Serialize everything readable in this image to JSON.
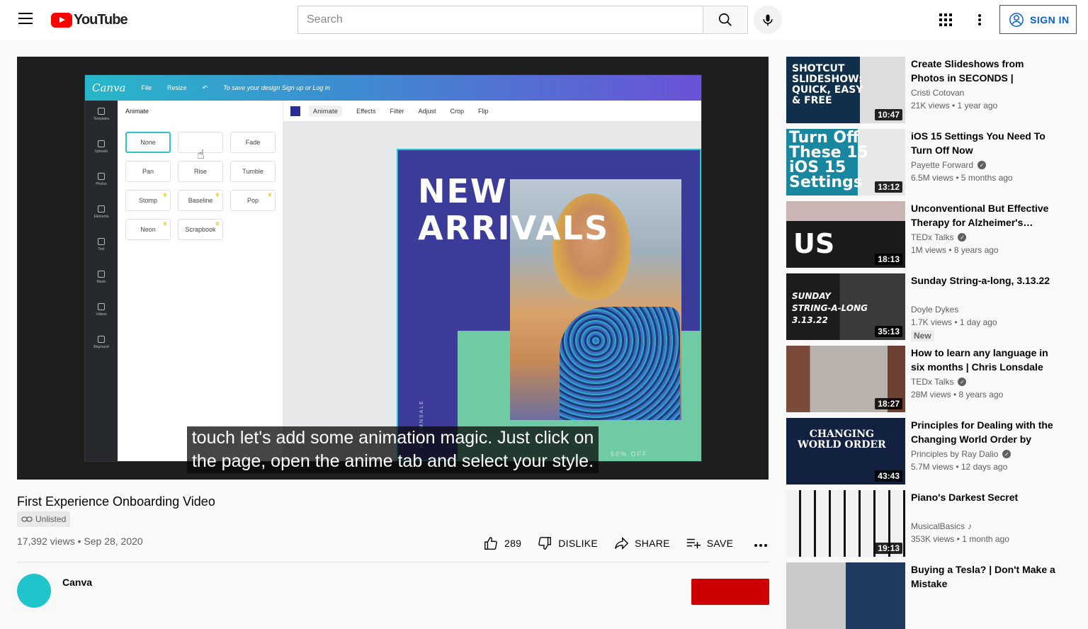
{
  "header": {
    "logo_text": "YouTube",
    "search_placeholder": "Search",
    "signin_label": "SIGN IN"
  },
  "player": {
    "canva": {
      "logo": "Canva",
      "menu_file": "File",
      "menu_resize": "Resize",
      "save_prompt": "To save your design Sign up or Log in",
      "panel_title": "Animate",
      "sidebar": [
        "Templates",
        "Uploads",
        "Photos",
        "Elements",
        "Text",
        "Music",
        "Videos",
        "Bkground"
      ],
      "animations": [
        {
          "label": "None",
          "premium": false,
          "selected": true
        },
        {
          "label": "",
          "premium": false,
          "selected": false
        },
        {
          "label": "Fade",
          "premium": false,
          "selected": false
        },
        {
          "label": "Pan",
          "premium": false,
          "selected": false
        },
        {
          "label": "Rise",
          "premium": false,
          "selected": false
        },
        {
          "label": "Tumble",
          "premium": false,
          "selected": false
        },
        {
          "label": "Stomp",
          "premium": true,
          "selected": false
        },
        {
          "label": "Baseline",
          "premium": true,
          "selected": false
        },
        {
          "label": "Pop",
          "premium": true,
          "selected": false
        },
        {
          "label": "Neon",
          "premium": true,
          "selected": false
        },
        {
          "label": "Scrapbook",
          "premium": true,
          "selected": false
        }
      ],
      "toolbar": [
        "Animate",
        "Effects",
        "Filter",
        "Adjust",
        "Crop",
        "Flip"
      ],
      "design_title_line1": "NEW",
      "design_title_line2": "ARRIVALS",
      "design_vertical": "AUTUMNSALE",
      "design_offer": "50% OFF"
    },
    "caption_line1": "touch let's add some animation magic. Just click on",
    "caption_line2": "the page, open the anime tab and select your style."
  },
  "video": {
    "title": "First Experience Onboarding Video",
    "visibility": "Unlisted",
    "meta": "17,392 views • Sep 28, 2020",
    "likes": "289",
    "dislike_label": "DISLIKE",
    "share_label": "SHARE",
    "save_label": "SAVE",
    "channel_name": "Canva"
  },
  "related": [
    {
      "title": "Create Slideshows from Photos in SECONDS | Quickest, Easies…",
      "channel": "Cristi Cotovan",
      "verified": false,
      "stats": "21K views • 1 year ago",
      "duration": "10:47",
      "thumb_text": "SHOTCUT\nSLIDESHOW:\nQUICK, EASY\n& FREE"
    },
    {
      "title": "iOS 15 Settings You Need To Turn Off Now",
      "channel": "Payette Forward",
      "verified": true,
      "stats": "6.5M views • 5 months ago",
      "duration": "13:12",
      "thumb_text": "Turn Off\nThese 15\niOS 15\nSettings"
    },
    {
      "title": "Unconventional But Effective Therapy for Alzheimer's…",
      "channel": "TEDx Talks",
      "verified": true,
      "stats": "1M views • 8 years ago",
      "duration": "18:13",
      "thumb_text": "US"
    },
    {
      "title": "Sunday String-a-long, 3.13.22",
      "channel": "Doyle Dykes",
      "verified": false,
      "stats": "1.7K views • 1 day ago",
      "duration": "35:13",
      "badge": "New",
      "thumb_text": "SUNDAY\nSTRING-A-LONG\n3.13.22"
    },
    {
      "title": "How to learn any language in six months | Chris Lonsdale |…",
      "channel": "TEDx Talks",
      "verified": true,
      "stats": "28M views • 8 years ago",
      "duration": "18:27",
      "thumb_text": ""
    },
    {
      "title": "Principles for Dealing with the Changing World Order by Ray…",
      "channel": "Principles by Ray Dalio",
      "verified": true,
      "stats": "5.7M views • 12 days ago",
      "duration": "43:43",
      "thumb_text": "CHANGING\nWORLD ORDER"
    },
    {
      "title": "Piano's Darkest Secret",
      "channel": "MusicalBasics",
      "verified": false,
      "music": true,
      "stats": "353K views • 1 month ago",
      "duration": "19:13",
      "thumb_text": ""
    },
    {
      "title": "Buying a Tesla? | Don't Make a Mistake",
      "channel": "",
      "verified": false,
      "stats": "",
      "duration": "",
      "thumb_text": ""
    }
  ],
  "colors": {
    "brand_red": "#ff0000",
    "link_blue": "#065fd4",
    "canva_teal": "#2ec4c9",
    "design_purple": "#3b3c99",
    "design_green": "#6ecba3"
  }
}
